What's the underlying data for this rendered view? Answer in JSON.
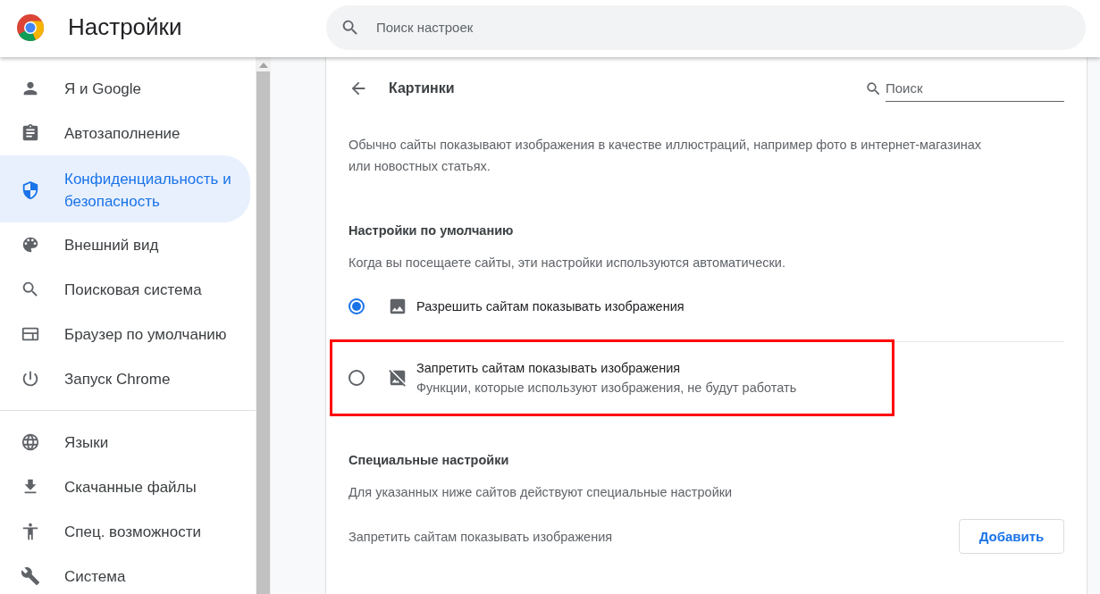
{
  "header": {
    "title": "Настройки",
    "search": {
      "placeholder": "Поиск настроек"
    }
  },
  "sidebar": {
    "groups": [
      {
        "items": [
          {
            "label": "Я и Google",
            "selected": false
          },
          {
            "label": "Автозаполнение",
            "selected": false
          },
          {
            "label": "Конфиденциальность и безопасность",
            "selected": true
          },
          {
            "label": "Внешний вид",
            "selected": false
          },
          {
            "label": "Поисковая система",
            "selected": false
          },
          {
            "label": "Браузер по умолчанию",
            "selected": false
          },
          {
            "label": "Запуск Chrome",
            "selected": false
          }
        ]
      },
      {
        "items": [
          {
            "label": "Языки",
            "selected": false
          },
          {
            "label": "Скачанные файлы",
            "selected": false
          },
          {
            "label": "Спец. возможности",
            "selected": false
          },
          {
            "label": "Система",
            "selected": false
          }
        ]
      }
    ]
  },
  "page": {
    "title": "Картинки",
    "search": {
      "placeholder": "Поиск"
    },
    "description": "Обычно сайты показывают изображения в качестве иллюстраций, например фото в интернет-магазинах или новостных статьях.",
    "default_section": {
      "heading": "Настройки по умолчанию",
      "subtitle": "Когда вы посещаете сайты, эти настройки используются автоматически.",
      "options": [
        {
          "label": "Разрешить сайтам показывать изображения",
          "selected": true,
          "highlighted": false
        },
        {
          "label": "Запретить сайтам показывать изображения",
          "description": "Функции, которые используют изображения, не будут работать",
          "selected": false,
          "highlighted": true
        }
      ]
    },
    "custom_section": {
      "heading": "Специальные настройки",
      "subtitle": "Для указанных ниже сайтов действуют специальные настройки",
      "rows": [
        {
          "label": "Запретить сайтам показывать изображения",
          "button": "Добавить"
        }
      ]
    }
  }
}
